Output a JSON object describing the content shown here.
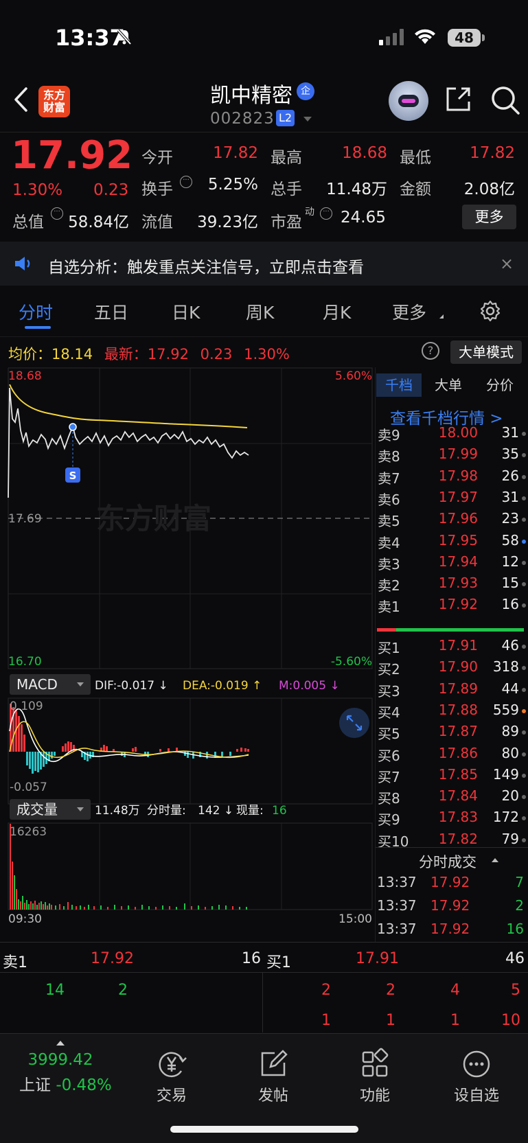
{
  "status_bar": {
    "time": "13:37",
    "battery": "48"
  },
  "header": {
    "logo_line1": "东方",
    "logo_line2": "财富",
    "stock_name": "凯中精密",
    "badge_qi": "企",
    "stock_code": "002823",
    "badge_l2": "L2"
  },
  "quote": {
    "price": "17.92",
    "pct": "1.30%",
    "change": "0.23",
    "fields": {
      "open_label": "今开",
      "open": "17.82",
      "high_label": "最高",
      "high": "18.68",
      "low_label": "最低",
      "low": "17.82",
      "turnover_label": "换手",
      "turnover": "5.25%",
      "vol_label": "总手",
      "vol": "11.48万",
      "amount_label": "金额",
      "amount": "2.08亿",
      "mktcap_label": "总值",
      "mktcap": "58.84亿",
      "float_label": "流值",
      "float": "39.23亿",
      "pe_label": "市盈",
      "pe_sup": "动",
      "pe": "24.65"
    },
    "more_button": "更多"
  },
  "notice": {
    "text": "自选分析：触发重点关注信号，立即点击查看",
    "close": "×"
  },
  "tabs": {
    "fenshi": "分时",
    "wuri": "五日",
    "rik": "日K",
    "zhouk": "周K",
    "yuek": "月K",
    "more": "更多"
  },
  "info_row": {
    "avg_label": "均价：",
    "avg": "18.14",
    "latest_label": "最新：",
    "latest": "17.92",
    "change": "0.23",
    "pct": "1.30%",
    "help": "?",
    "bigorder_button": "大单模式"
  },
  "price_chart": {
    "y_top": "18.68",
    "y_pref": "17.69",
    "y_bottom": "16.70",
    "pct_top": "5.60%",
    "pct_bottom": "-5.60%",
    "marker": "S",
    "watermark": "东方财富"
  },
  "macd": {
    "selector": "MACD",
    "dif": "DIF:-0.017 ↓",
    "dea": "DEA:-0.019 ↑",
    "m": "M:0.005 ↓",
    "y_top": "0.109",
    "y_bottom": "-0.057"
  },
  "volume": {
    "selector": "成交量",
    "total": "11.48万",
    "period_label": "分时量:",
    "period": "142 ↓",
    "now_label": "现量:",
    "now": "16",
    "y_top": "16263",
    "x_start": "09:30",
    "x_end": "15:00"
  },
  "orderbook": {
    "tabs": [
      "千档",
      "大单",
      "分价"
    ],
    "link": "查看千档行情 >",
    "asks": [
      {
        "label": "卖9",
        "price": "18.00",
        "vol": "31"
      },
      {
        "label": "卖8",
        "price": "17.99",
        "vol": "35"
      },
      {
        "label": "卖7",
        "price": "17.98",
        "vol": "26"
      },
      {
        "label": "卖6",
        "price": "17.97",
        "vol": "31"
      },
      {
        "label": "卖5",
        "price": "17.96",
        "vol": "23"
      },
      {
        "label": "卖4",
        "price": "17.95",
        "vol": "58"
      },
      {
        "label": "卖3",
        "price": "17.94",
        "vol": "12"
      },
      {
        "label": "卖2",
        "price": "17.93",
        "vol": "15"
      },
      {
        "label": "卖1",
        "price": "17.92",
        "vol": "16"
      }
    ],
    "bids": [
      {
        "label": "买1",
        "price": "17.91",
        "vol": "46"
      },
      {
        "label": "买2",
        "price": "17.90",
        "vol": "318"
      },
      {
        "label": "买3",
        "price": "17.89",
        "vol": "44"
      },
      {
        "label": "买4",
        "price": "17.88",
        "vol": "559"
      },
      {
        "label": "买5",
        "price": "17.87",
        "vol": "89"
      },
      {
        "label": "买6",
        "price": "17.86",
        "vol": "80"
      },
      {
        "label": "买7",
        "price": "17.85",
        "vol": "149"
      },
      {
        "label": "买8",
        "price": "17.84",
        "vol": "20"
      },
      {
        "label": "买9",
        "price": "17.83",
        "vol": "172"
      },
      {
        "label": "买10",
        "price": "17.82",
        "vol": "79"
      }
    ]
  },
  "ticks": {
    "title": "分时成交",
    "rows": [
      {
        "time": "13:37",
        "price": "17.92",
        "vol": "7"
      },
      {
        "time": "13:37",
        "price": "17.92",
        "vol": "2"
      },
      {
        "time": "13:37",
        "price": "17.92",
        "vol": "16"
      }
    ]
  },
  "strip": {
    "ask_label": "卖1",
    "ask_price": "17.92",
    "ask_vol": "16",
    "bid_label": "买1",
    "bid_price": "17.91",
    "bid_vol": "46",
    "left_q1": "14",
    "left_q2": "2",
    "right_row1": [
      "2",
      "2",
      "4",
      "5"
    ],
    "right_row2": [
      "1",
      "1",
      "1",
      "10"
    ]
  },
  "nav": {
    "index_value": "3999.42",
    "index_name": "上证",
    "index_pct": "-0.48%",
    "trade": "交易",
    "post": "发帖",
    "function": "功能",
    "watchlist": "设自选"
  },
  "colors": {
    "up": "#f0353b",
    "down": "#20c34a",
    "accent": "#3a7ff5",
    "avg_line": "#f5d63c"
  }
}
